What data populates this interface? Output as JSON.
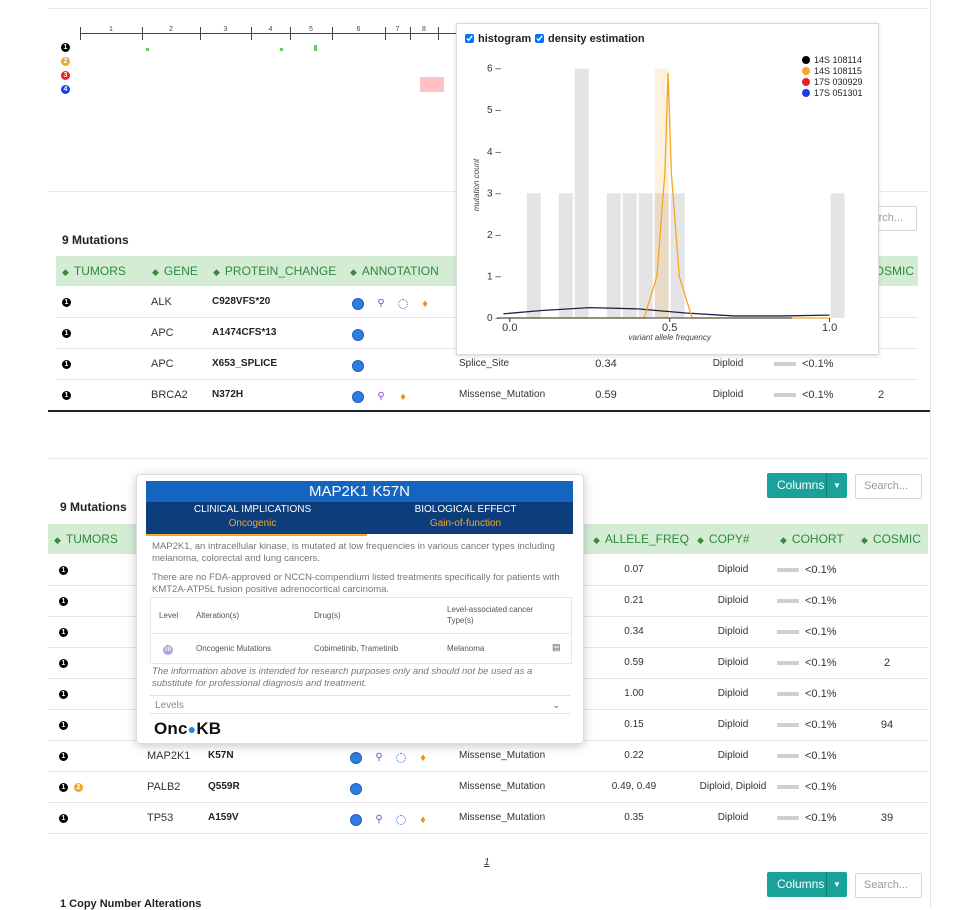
{
  "timeline": {
    "ticks": [
      "1",
      "2",
      "3",
      "4",
      "5",
      "6",
      "7",
      "8"
    ],
    "tumor_markers": [
      {
        "label": "1",
        "color": "#000000"
      },
      {
        "label": "2",
        "color": "#f5a623"
      },
      {
        "label": "3",
        "color": "#e8202a"
      },
      {
        "label": "4",
        "color": "#1c3ce8"
      }
    ]
  },
  "top_table": {
    "title": "9 Mutations",
    "search_placeholder": "Search...",
    "columns": [
      "TUMORS",
      "GENE",
      "PROTEIN_CHANGE",
      "ANNOTATION",
      "COSMIC"
    ],
    "rows": [
      {
        "tumors": [
          "1"
        ],
        "gene": "ALK",
        "protein_change": "C928VFS*20",
        "mutation_type": "",
        "allele_freq": "",
        "copy": "",
        "cohort": "",
        "cosmic": "",
        "icons": [
          "blue-circle-icon",
          "purple-drop-icon",
          "dotted-circle-icon",
          "flame-icon"
        ]
      },
      {
        "tumors": [
          "1"
        ],
        "gene": "APC",
        "protein_change": "A1474CFS*13",
        "mutation_type": "",
        "allele_freq": "",
        "copy": "",
        "cohort": "",
        "cosmic": "",
        "icons": [
          "blue-circle-icon"
        ]
      },
      {
        "tumors": [
          "1"
        ],
        "gene": "APC",
        "protein_change": "X653_SPLICE",
        "mutation_type": "Splice_Site",
        "allele_freq": "0.34",
        "copy": "Diploid",
        "cohort": "<0.1%",
        "cosmic": "",
        "icons": [
          "blue-circle-icon"
        ]
      },
      {
        "tumors": [
          "1"
        ],
        "gene": "BRCA2",
        "protein_change": "N372H",
        "mutation_type": "Missense_Mutation",
        "allele_freq": "0.59",
        "copy": "Diploid",
        "cohort": "<0.1%",
        "cosmic": "2",
        "icons": [
          "blue-circle-icon",
          "purple-drop-icon",
          "flame-icon"
        ]
      }
    ]
  },
  "histogram": {
    "checkbox_histogram": "histogram",
    "checkbox_density": "density estimation",
    "legend": [
      {
        "name": "14S 108114",
        "color": "#000000"
      },
      {
        "name": "14S 108115",
        "color": "#f5a623"
      },
      {
        "name": "17S 030929",
        "color": "#e8202a"
      },
      {
        "name": "17S 051301",
        "color": "#1c3ce8"
      }
    ]
  },
  "chart_data": {
    "type": "bar",
    "xlabel": "variant allele frequency",
    "ylabel": "mutation count",
    "xlim": [
      -0.04,
      1.07
    ],
    "ylim": [
      0,
      6.4
    ],
    "x_ticks": [
      "0.0",
      "0.5",
      "1.0"
    ],
    "y_ticks": [
      "1",
      "2",
      "3",
      "4",
      "5",
      "6"
    ],
    "bin_width": 0.05,
    "series": [
      {
        "name": "14S 108114",
        "bins": [
          [
            0.05,
            3
          ],
          [
            0.15,
            3
          ],
          [
            0.2,
            6
          ],
          [
            0.3,
            3
          ],
          [
            0.35,
            3
          ],
          [
            0.4,
            3
          ],
          [
            0.45,
            3
          ],
          [
            0.5,
            3
          ],
          [
            1.0,
            3
          ]
        ]
      },
      {
        "name": "14S 108115",
        "bins": [
          [
            0.45,
            6
          ]
        ]
      }
    ],
    "density": [
      {
        "name": "14S 108114",
        "points": [
          [
            -0.02,
            0.1
          ],
          [
            0.1,
            0.18
          ],
          [
            0.25,
            0.25
          ],
          [
            0.4,
            0.22
          ],
          [
            0.55,
            0.12
          ],
          [
            0.7,
            0.05
          ],
          [
            0.85,
            0.05
          ],
          [
            1.0,
            0.07
          ]
        ]
      },
      {
        "name": "14S 108115",
        "points": [
          [
            -0.02,
            0.0
          ],
          [
            0.42,
            0.0
          ],
          [
            0.46,
            1.0
          ],
          [
            0.485,
            3.5
          ],
          [
            0.495,
            5.9
          ],
          [
            0.505,
            3.5
          ],
          [
            0.53,
            1.0
          ],
          [
            0.57,
            0.0
          ],
          [
            1.0,
            0.0
          ]
        ]
      }
    ]
  },
  "controls": {
    "columns_label": "Columns",
    "search_placeholder": "Search..."
  },
  "bottom_table": {
    "title": "9 Mutations",
    "columns": [
      "TUMORS",
      "ALLELE_FREQ",
      "COPY#",
      "COHORT",
      "COSMIC"
    ],
    "rows": [
      {
        "tumors": [
          "1"
        ],
        "gene": "",
        "protein_change": "",
        "mutation_type": "",
        "allele_freq": "0.07",
        "copy": "Diploid",
        "cohort": "<0.1%",
        "cosmic": "",
        "icons": []
      },
      {
        "tumors": [
          "1"
        ],
        "gene": "",
        "protein_change": "",
        "mutation_type": "",
        "allele_freq": "0.21",
        "copy": "Diploid",
        "cohort": "<0.1%",
        "cosmic": "",
        "icons": []
      },
      {
        "tumors": [
          "1"
        ],
        "gene": "",
        "protein_change": "",
        "mutation_type": "",
        "allele_freq": "0.34",
        "copy": "Diploid",
        "cohort": "<0.1%",
        "cosmic": "",
        "icons": []
      },
      {
        "tumors": [
          "1"
        ],
        "gene": "",
        "protein_change": "",
        "mutation_type": "",
        "allele_freq": "0.59",
        "copy": "Diploid",
        "cohort": "<0.1%",
        "cosmic": "2",
        "icons": []
      },
      {
        "tumors": [
          "1"
        ],
        "gene": "",
        "protein_change": "",
        "mutation_type": "",
        "allele_freq": "1.00",
        "copy": "Diploid",
        "cohort": "<0.1%",
        "cosmic": "",
        "icons": []
      },
      {
        "tumors": [
          "1"
        ],
        "gene": "",
        "protein_change": "",
        "mutation_type": "",
        "allele_freq": "0.15",
        "copy": "Diploid",
        "cohort": "<0.1%",
        "cosmic": "94",
        "icons": []
      },
      {
        "tumors": [
          "1"
        ],
        "gene": "MAP2K1",
        "protein_change": "K57N",
        "mutation_type": "Missense_Mutation",
        "allele_freq": "0.22",
        "copy": "Diploid",
        "cohort": "<0.1%",
        "cosmic": "",
        "icons": [
          "blue-circle-icon",
          "purple-drop-icon",
          "dotted-circle-icon",
          "flame-icon"
        ]
      },
      {
        "tumors": [
          "1",
          "2"
        ],
        "gene": "PALB2",
        "protein_change": "Q559R",
        "mutation_type": "Missense_Mutation",
        "allele_freq": "0.49, 0.49",
        "copy": "Diploid, Diploid",
        "cohort": "<0.1%",
        "cosmic": "",
        "icons": [
          "blue-circle-icon"
        ]
      },
      {
        "tumors": [
          "1"
        ],
        "gene": "TP53",
        "protein_change": "A159V",
        "mutation_type": "Missense_Mutation",
        "allele_freq": "0.35",
        "copy": "Diploid",
        "cohort": "<0.1%",
        "cosmic": "39",
        "icons": [
          "blue-circle-icon",
          "purple-drop-icon",
          "dotted-circle-icon",
          "flame-icon"
        ]
      }
    ]
  },
  "oncokb": {
    "title": "MAP2K1 K57N",
    "tab1": "CLINICAL IMPLICATIONS",
    "tab1_value": "Oncogenic",
    "tab2": "BIOLOGICAL EFFECT",
    "tab2_value": "Gain-of-function",
    "description": "MAP2K1, an intracellular kinase, is mutated at low frequencies in various cancer types including melanoma, colorectal and lung cancers.",
    "treatment_note": "There are no FDA-approved or NCCN-compendium listed treatments specifically for patients with KMT2A-ATP5L fusion positive adrenocortical carcinoma.",
    "table": {
      "headers": [
        "Level",
        "Alteration(s)",
        "Drug(s)",
        "Level-associated cancer Type(s)"
      ],
      "row": {
        "level": "3B",
        "alteration": "Oncogenic Mutations",
        "drugs": "Cobimetinib, Trametinib",
        "cancer_type": "Melanoma"
      }
    },
    "disclaimer": "The information above is intended for research purposes only and should not be used as a substitute for professional diagnosis and treatment.",
    "levels_label": "Levels",
    "logo_text_a": "Onc",
    "logo_text_b": "KB"
  },
  "pagination": {
    "current_page": "1"
  },
  "cna": {
    "title": "1 Copy Number Alterations",
    "columns_label": "Columns",
    "search_placeholder": "Search..."
  }
}
